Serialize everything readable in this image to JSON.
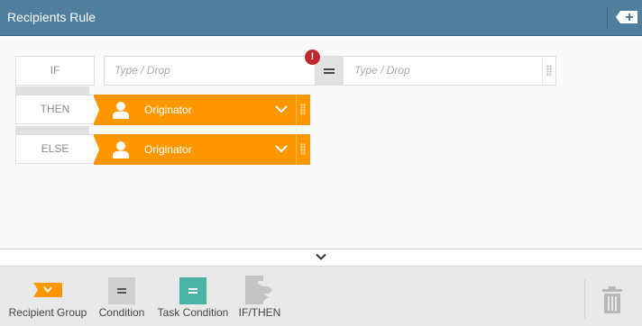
{
  "header": {
    "title": "Recipients Rule",
    "add_icon": "plus-tag-icon"
  },
  "rule": {
    "if_label": "IF",
    "then_label": "THEN",
    "else_label": "ELSE",
    "left_placeholder": "Type / Drop",
    "right_placeholder": "Type / Drop",
    "warning_glyph": "!",
    "warning_color": "#c0272d",
    "then_value": "Originator",
    "else_value": "Originator",
    "recipient_color": "#ff9800"
  },
  "palette": {
    "items": [
      {
        "label": "Recipient Group",
        "icon": "recipient-group-icon",
        "color": "#ff9800"
      },
      {
        "label": "Condition",
        "icon": "condition-icon",
        "color": "#d0d0d0"
      },
      {
        "label": "Task Condition",
        "icon": "task-condition-icon",
        "color": "#4bb3a8"
      },
      {
        "label": "IF/THEN",
        "icon": "if-then-icon",
        "color": "#c4c4c4"
      }
    ],
    "trash_icon": "trash-icon"
  }
}
